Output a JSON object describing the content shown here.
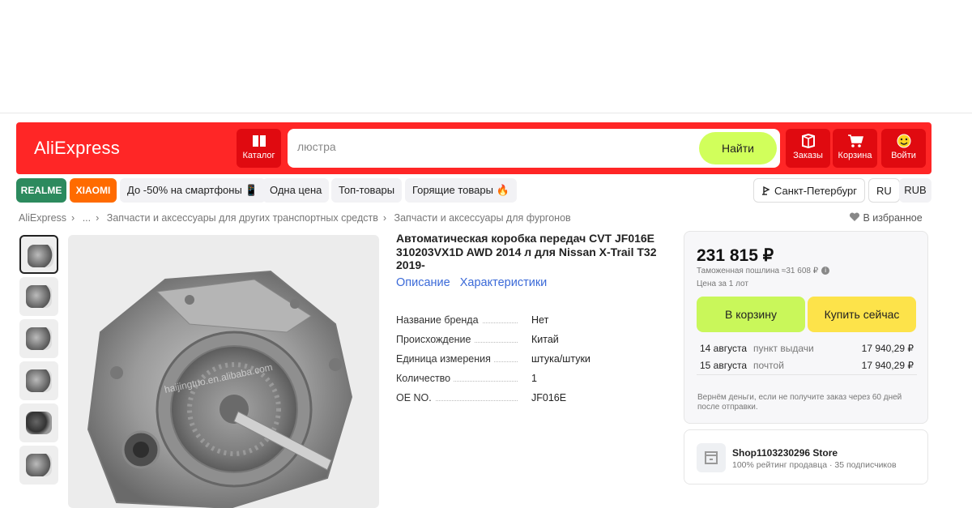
{
  "header": {
    "logo": "AliExpress",
    "catalog_label": "Каталог",
    "search_placeholder": "люстра",
    "search_button": "Найти",
    "orders_label": "Заказы",
    "cart_label": "Корзина",
    "login_label": "Войти",
    "brand_color": "#ff2626"
  },
  "chips": {
    "realme": "REALME",
    "xiaomi": "XIAOMI",
    "promo": "До -50% на смартфоны 📱",
    "one_price": "Одна цена",
    "top": "Топ-товары",
    "hot": "Горящие товары 🔥",
    "city": "Санкт-Петербург",
    "lang": "RU",
    "currency": "RUB"
  },
  "breadcrumbs": [
    "AliExpress",
    "...",
    "Запчасти и аксессуары для других транспортных средств",
    "Запчасти и аксессуары для фургонов"
  ],
  "favorites_label": "В избранное",
  "product": {
    "title": "Автоматическая коробка передач CVT JF016E 310203VX1D AWD 2014 л для Nissan X-Trail T32 2019-",
    "tab_description": "Описание",
    "tab_specs": "Характеристики",
    "watermark": "haijingtuo.en.alibaba.com",
    "specs": [
      {
        "key": "Название бренда",
        "value": "Нет"
      },
      {
        "key": "Происхождение",
        "value": "Китай"
      },
      {
        "key": "Единица измерения",
        "value": "штука/штуки"
      },
      {
        "key": "Количество",
        "value": "1"
      },
      {
        "key": "OE NO.",
        "value": "JF016E"
      }
    ]
  },
  "buybox": {
    "price": "231 815 ₽",
    "duty": "Таможенная пошлина ≈31 608 ₽",
    "lot": "Цена за 1 лот",
    "add_to_cart": "В корзину",
    "buy_now": "Купить сейчас",
    "shipping": [
      {
        "date": "14 августа",
        "method": "пункт выдачи",
        "price": "17 940,29 ₽"
      },
      {
        "date": "15 августа",
        "method": "почтой",
        "price": "17 940,29 ₽"
      }
    ],
    "refund": "Вернём деньги, если не получите заказ через 60 дней после отправки."
  },
  "store": {
    "name": "Shop1103230296 Store",
    "rating": "100% рейтинг продавца · 35 подписчиков"
  },
  "icons": [
    "catalog-icon",
    "orders-icon",
    "cart-icon",
    "login-icon",
    "location-icon",
    "heart-icon",
    "info-icon",
    "store-icon"
  ]
}
